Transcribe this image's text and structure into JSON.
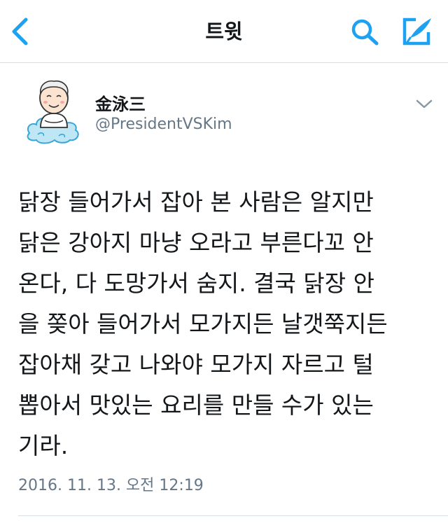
{
  "nav": {
    "title": "트윗",
    "back_icon": "chevron-left-icon",
    "search_icon": "search-icon",
    "compose_icon": "compose-icon"
  },
  "colors": {
    "accent": "#1da1f2",
    "text": "#14171a",
    "secondary": "#657786",
    "divider": "#d8dde2"
  },
  "tweet": {
    "display_name": "金泳三",
    "username": "@PresidentVSKim",
    "text_lines": [
      "닭장 들어가서 잡아 본 사람은 알지만",
      "닭은 강아지 마냥 오라고 부른다꼬 안",
      "온다, 다 도망가서 숨지. 결국 닭장 안",
      "을 쫒아 들어가서 모가지든 날갯쭉지든",
      "잡아채 갖고 나와야 모가지 자르고 털",
      "뽑아서 맛있는 요리를 만들 수가 있는",
      "기라."
    ],
    "timestamp": "2016. 11. 13. 오전 12:19"
  }
}
